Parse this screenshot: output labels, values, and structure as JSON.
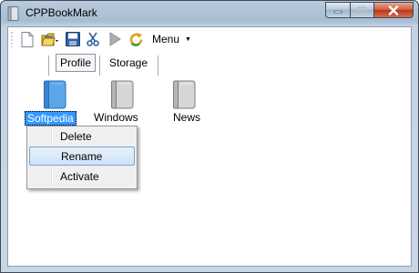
{
  "window": {
    "title": "CPPBookMark"
  },
  "toolbar": {
    "icons": [
      "new-document-icon",
      "open-folder-icon",
      "save-icon",
      "cut-icon",
      "play-icon",
      "refresh-icon"
    ],
    "menu_label": "Menu"
  },
  "tabs": [
    {
      "label": "Profile",
      "selected": true
    },
    {
      "label": "Storage",
      "selected": false
    }
  ],
  "bookmarks": [
    {
      "label": "Softpedia",
      "selected": true,
      "color": "#5aa6e8"
    },
    {
      "label": "Windows",
      "selected": false,
      "color": "#c9c9c9"
    },
    {
      "label": "News",
      "selected": false,
      "color": "#c9c9c9"
    }
  ],
  "context_menu": {
    "items": [
      {
        "label": "Delete",
        "highlighted": false
      },
      {
        "label": "Rename",
        "highlighted": true
      },
      {
        "label": "Activate",
        "highlighted": false
      }
    ]
  }
}
